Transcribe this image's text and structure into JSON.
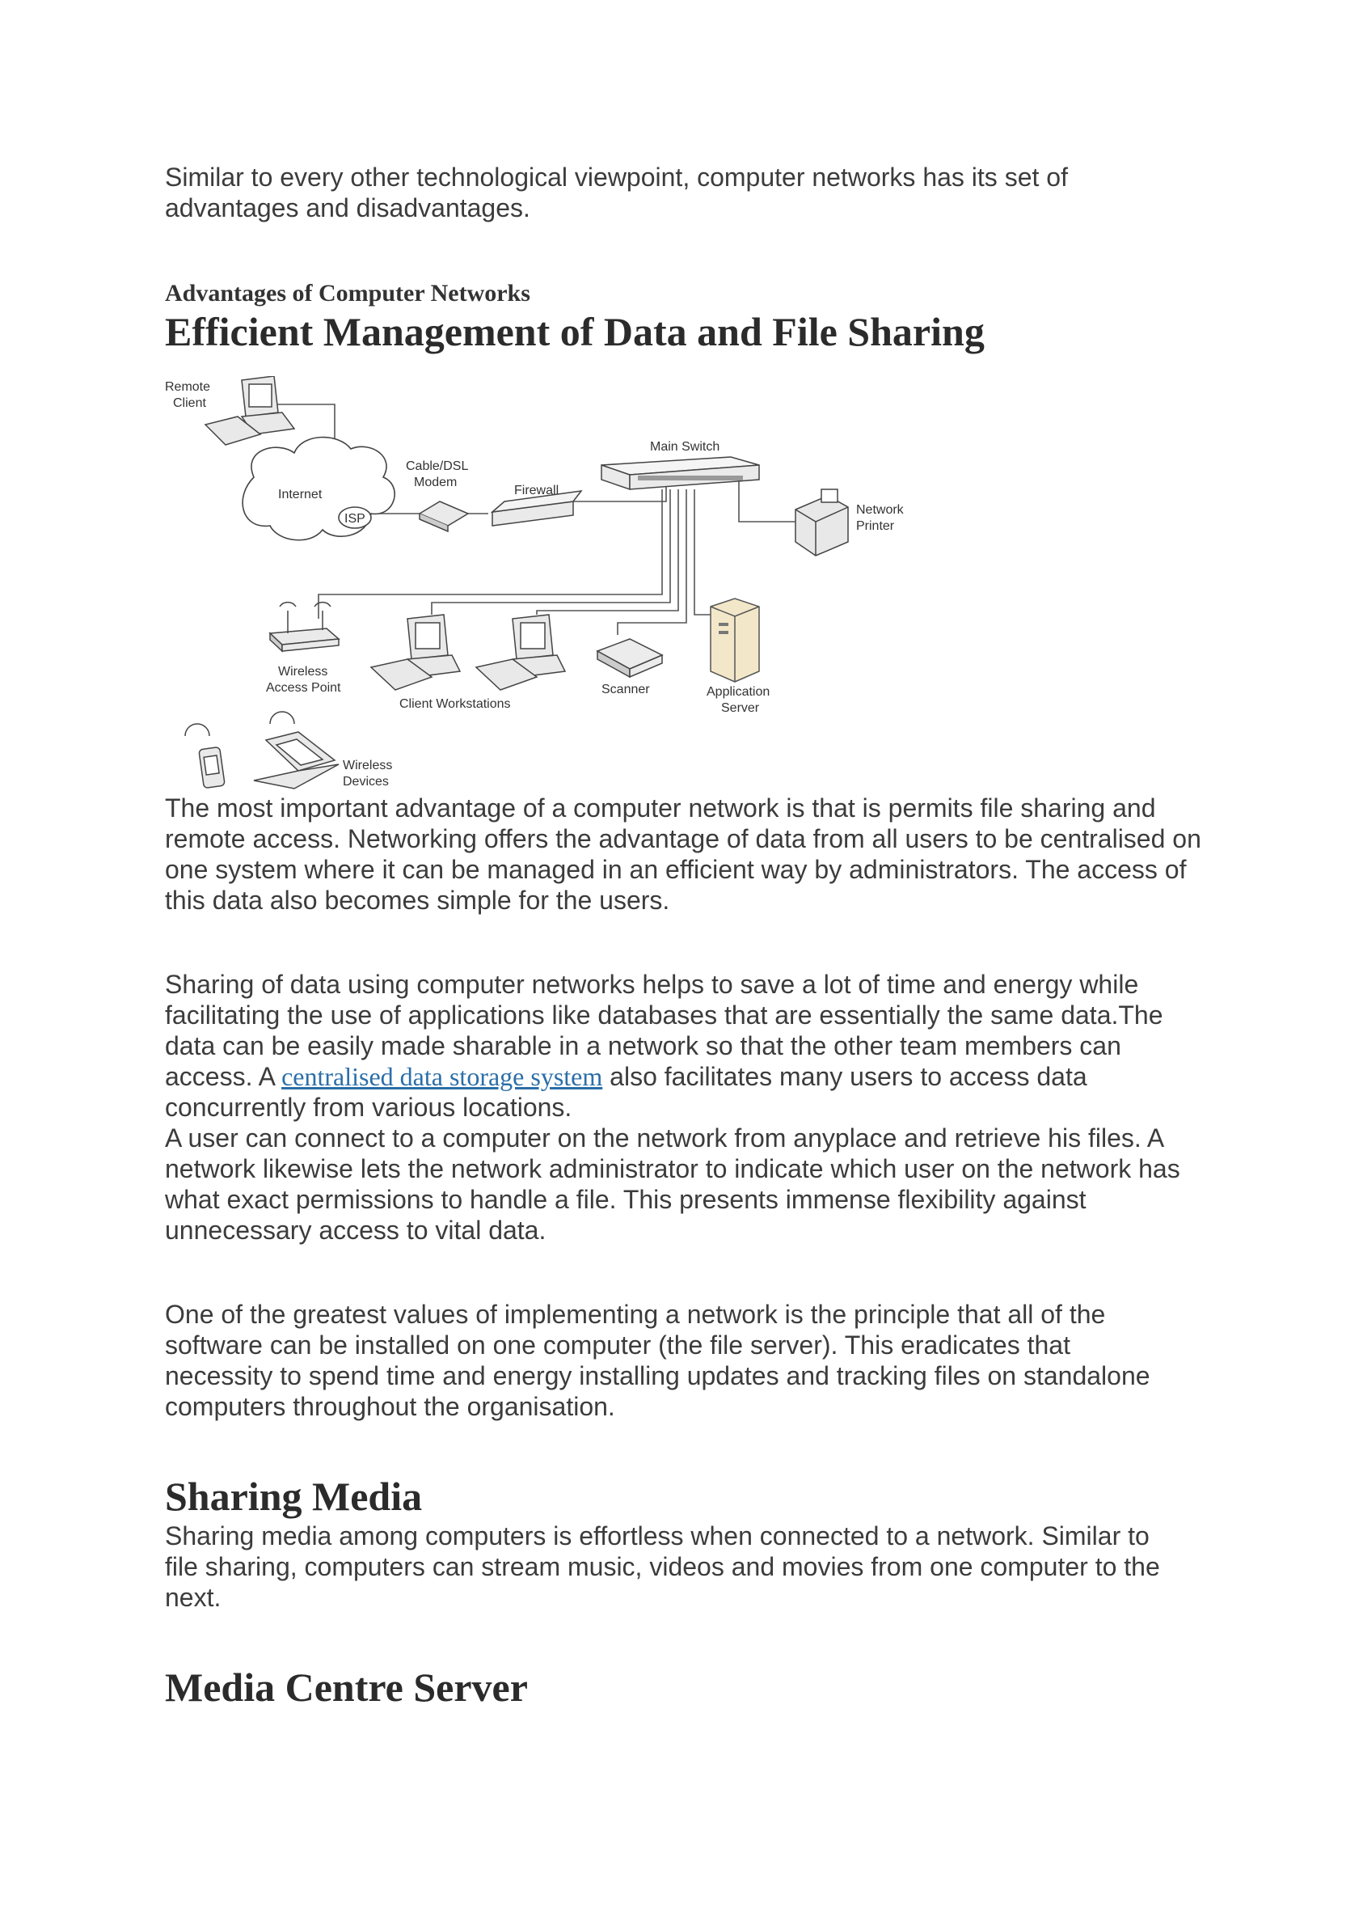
{
  "intro": "Similar to every other technological viewpoint, computer networks has its set of advantages and disadvantages.",
  "section_label": "Advantages of Computer Networks",
  "h_efficient": "Efficient Management of Data and File Sharing",
  "diagram": {
    "remote_client": [
      "Remote",
      "Client"
    ],
    "internet": "Internet",
    "isp": "ISP",
    "modem": [
      "Cable/DSL",
      "Modem"
    ],
    "firewall": "Firewall",
    "main_switch": "Main Switch",
    "network_printer": [
      "Network",
      "Printer"
    ],
    "wireless_ap": [
      "Wireless",
      "Access Point"
    ],
    "client_workstations": "Client Workstations",
    "scanner": "Scanner",
    "app_server": [
      "Application",
      "Server"
    ],
    "wireless_devices": [
      "Wireless",
      "Devices"
    ]
  },
  "p1": "The most important advantage of a computer network is that is permits file sharing and remote access. Networking offers the advantage of data from all users to be centralised on one system where it can be managed in an efficient way by administrators. The access of this data also becomes simple for the users.",
  "p2_before": "Sharing of data using computer networks helps to save a lot of time and energy while facilitating the use of applications like databases that are essentially the same data.The data can be easily made sharable in a network so that the other team members can access. A ",
  "p2_link": "centralised data storage system",
  "p2_after": " also facilitates many users to access data concurrently from various locations.",
  "p3": "A user can connect to a computer on the network from anyplace and retrieve his files. A network likewise lets the network administrator to indicate which user on the network has what exact permissions to handle a file. This presents immense flexibility against unnecessary access to vital data.",
  "p4": "One of the greatest values of implementing a network is the principle that all of the software can be installed on one computer (the file server). This eradicates that necessity to spend time and energy installing updates and tracking files on standalone computers throughout the organisation.",
  "h_sharing": "Sharing Media",
  "p5": "Sharing media among computers is effortless when connected to a network. Similar to file sharing, computers can stream music, videos and movies from one computer to the next.",
  "h_media": "Media Centre Server"
}
